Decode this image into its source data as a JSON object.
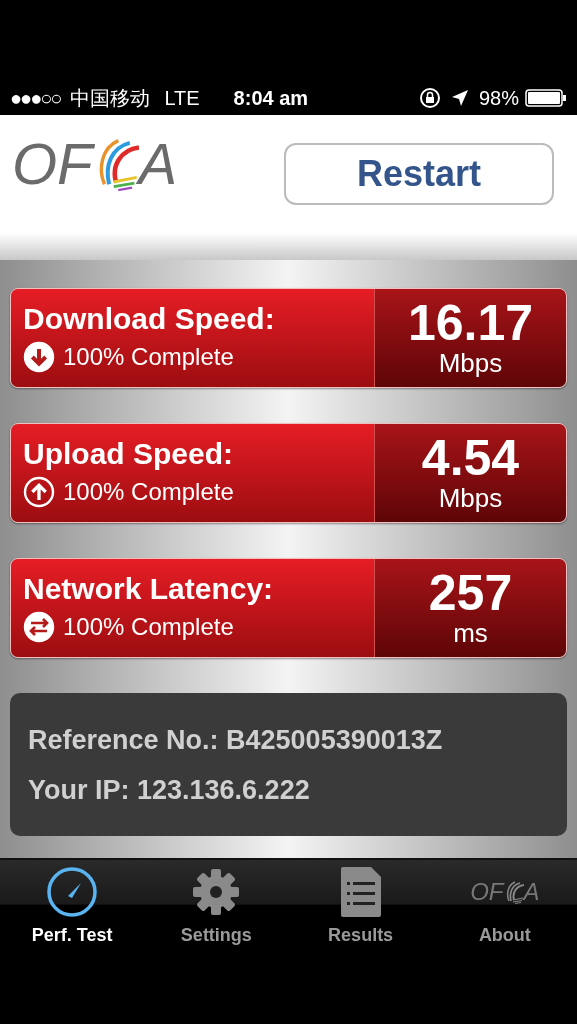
{
  "status_bar": {
    "signal": "●●●○○",
    "carrier": "中国移动",
    "network": "LTE",
    "time": "8:04 am",
    "battery": "98%"
  },
  "header": {
    "logo": {
      "left": "OF",
      "right": "A"
    },
    "button": "Restart"
  },
  "results": [
    {
      "kind": "download",
      "title": "Download Speed:",
      "progress": "100% Complete",
      "value": "16.17",
      "unit": "Mbps"
    },
    {
      "kind": "upload",
      "title": "Upload Speed:",
      "progress": "100% Complete",
      "value": "4.54",
      "unit": "Mbps"
    },
    {
      "kind": "latency",
      "title": "Network Latency:",
      "progress": "100% Complete",
      "value": "257",
      "unit": "ms"
    }
  ],
  "info": [
    "Reference No.: B425005390013Z",
    "Your IP: 123.136.6.222"
  ],
  "tabs": [
    {
      "kind": "gauge",
      "label": "Perf. Test",
      "selected": true
    },
    {
      "kind": "gear",
      "label": "Settings",
      "selected": false
    },
    {
      "kind": "document",
      "label": "Results",
      "selected": false
    },
    {
      "kind": "logo",
      "label": "About",
      "selected": false,
      "logo": {
        "left": "OF",
        "right": "A"
      }
    }
  ]
}
